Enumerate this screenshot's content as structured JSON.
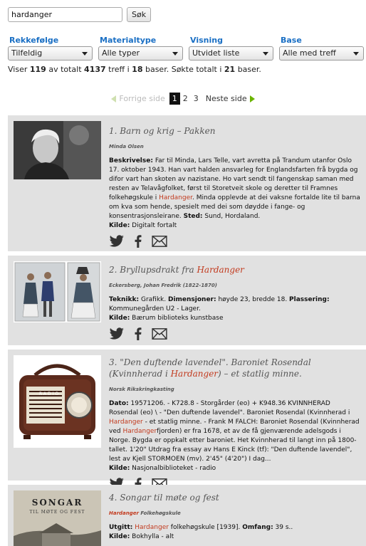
{
  "search": {
    "value": "hardanger",
    "button_label": "Søk"
  },
  "filters": [
    {
      "label": "Rekkefølge",
      "value": "Tilfeldig"
    },
    {
      "label": "Materialtype",
      "value": "Alle typer"
    },
    {
      "label": "Visning",
      "value": "Utvidet liste"
    },
    {
      "label": "Base",
      "value": "Alle med treff"
    }
  ],
  "summary": {
    "t1": "Viser ",
    "shown": "119",
    "t2": " av totalt ",
    "total": "4137",
    "t3": " treff i ",
    "bases": "18",
    "t4": " baser. Søkte totalt i ",
    "searched": "21",
    "t5": " baser."
  },
  "pager": {
    "prev_label": "Forrige side",
    "pages": [
      "1",
      "2",
      "3"
    ],
    "current": "1",
    "next_label": "Neste side"
  },
  "results": [
    {
      "title": "1. Barn og krig – Pakken",
      "creator": "Minda Olsen",
      "desc_label": "Beskrivelse:",
      "desc_1": " Far til Minda, Lars Telle, vart avretta på Trandum utanfor Oslo 17. oktober 1943. Han vart halden ansvarleg for Englandsfarten frå bygda og difor vart han skoten av nazistane. Ho vart sendt til fangenskap saman med resten av Telavågfolket, først til Storetveit skole og deretter til Framnes folkehøgskule i ",
      "desc_hl": "Hardanger",
      "desc_2": ". Minda opplevde at dei vaksne fortalde lite til barna om kva som hende, spesielt med dei som døydde i fange- og konsentrasjonsleirane. ",
      "place_label": "Sted:",
      "place_value": " Sund, Hordaland.",
      "source_label": "Kilde:",
      "source_value": " Digitalt fortalt"
    },
    {
      "title_pre": "2. Bryllupsdrakt fra ",
      "title_hl": "Hardanger",
      "creator": "Eckersberg, Johan Fredrik (1822-1870)",
      "technique_label": "Teknikk:",
      "technique_value": " Grafikk. ",
      "dim_label": "Dimensjoner:",
      "dim_value": " høyde 23, bredde 18. ",
      "placement_label": "Plassering:",
      "placement_value": " Kommunegården U2 - Lager.",
      "source_label": "Kilde:",
      "source_value": " Bærum biblioteks kunstbase"
    },
    {
      "title_pre": "3. \"Den duftende lavendel\". Baroniet Rosendal (Kvinnherad i ",
      "title_hl": "Hardanger",
      "title_post": ") – et statlig minne.",
      "creator": "Norsk Rikskringkasting",
      "date_label": "Dato:",
      "desc_1": " 19571206. - K728.8 - Storgårder (eo) + K948.36 KVINNHERAD Rosendal (eo) \\ - \"Den duftende lavendel\". Baroniet Rosendal (Kvinnherad i ",
      "desc_hl1": "Hardanger",
      "desc_2": " - et statlig minne. - Frank M FALCH: Baroniet Rosendal (Kvinnherad ved ",
      "desc_hl2": "Hardanger",
      "desc_3": "fjorden) er fra 1678, et av de få gjenværende adelsgods i Norge. Bygda er oppkalt etter baroniet. Het Kvinnherad til langt inn på 1800-tallet. 1'20\" Utdrag fra essay av Hans E Kinck (tf): \"Den duftende lavendel\", lest av Kjell STORMOEN (mv). 2'45\" (4'20\") I dag...",
      "source_label": "Kilde:",
      "source_value": " Nasjonalbiblioteket - radio",
      "radio_text": "RADIO"
    },
    {
      "title": "4. Songar til møte og fest",
      "creator_hl": "Hardanger",
      "creator_post": " Folkehøgskule",
      "pub_label": "Utgitt:",
      "pub_hl": "Hardanger",
      "pub_value": " folkehøgskule [1939]. ",
      "extent_label": "Omfang:",
      "extent_value": " 39 s..",
      "source_label": "Kilde:",
      "source_value": " Bokhylla - alt",
      "cover_title": "SONGAR",
      "cover_sub": "TIL MØTE OG FEST"
    }
  ],
  "icons": {
    "twitter": "twitter-icon",
    "facebook": "facebook-icon",
    "email": "email-icon"
  },
  "colors": {
    "accent_blue": "#1a6fc4",
    "highlight": "#c23a1e",
    "result_bg": "#e1e1e1"
  }
}
